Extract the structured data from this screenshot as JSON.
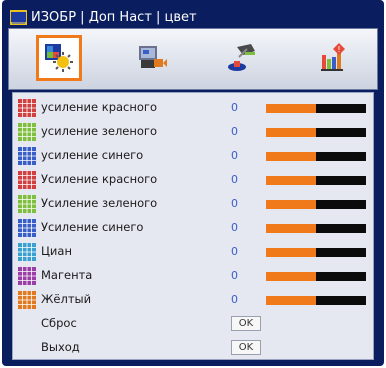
{
  "window": {
    "title": "ИЗОБР | Доп Наст | цвет"
  },
  "toolbar": {
    "items": [
      {
        "icon": "picture-settings-icon",
        "active": true
      },
      {
        "icon": "display-screen-icon",
        "active": false
      },
      {
        "icon": "setup-icon",
        "active": false
      },
      {
        "icon": "options-info-icon",
        "active": false
      }
    ]
  },
  "colors": {
    "accent": "#f07a1a",
    "value_text": "#3a5ec8",
    "background": "#0a1d5e",
    "panel": "#e5e8f0"
  },
  "settings": [
    {
      "label": "усиление красного",
      "value": "0",
      "level": 0.5,
      "icon_color": "#d04040"
    },
    {
      "label": "усиление зеленого",
      "value": "0",
      "level": 0.5,
      "icon_color": "#7fbf3f"
    },
    {
      "label": "усиление синего",
      "value": "0",
      "level": 0.5,
      "icon_color": "#3a5ec8"
    },
    {
      "label": "Усиление красного",
      "value": "0",
      "level": 0.5,
      "icon_color": "#d04040"
    },
    {
      "label": "Усиление зеленого",
      "value": "0",
      "level": 0.5,
      "icon_color": "#7fbf3f"
    },
    {
      "label": "Усиление синего",
      "value": "0",
      "level": 0.5,
      "icon_color": "#3a5ec8"
    },
    {
      "label": "Циан",
      "value": "0",
      "level": 0.5,
      "icon_color": "#3aa0d0"
    },
    {
      "label": "Магента",
      "value": "0",
      "level": 0.5,
      "icon_color": "#9b3fa8"
    },
    {
      "label": "Жёлтый",
      "value": "0",
      "level": 0.5,
      "icon_color": "#e07a20"
    }
  ],
  "actions": [
    {
      "label": "Сброс",
      "button": "OK"
    },
    {
      "label": "Выход",
      "button": "OK"
    }
  ]
}
